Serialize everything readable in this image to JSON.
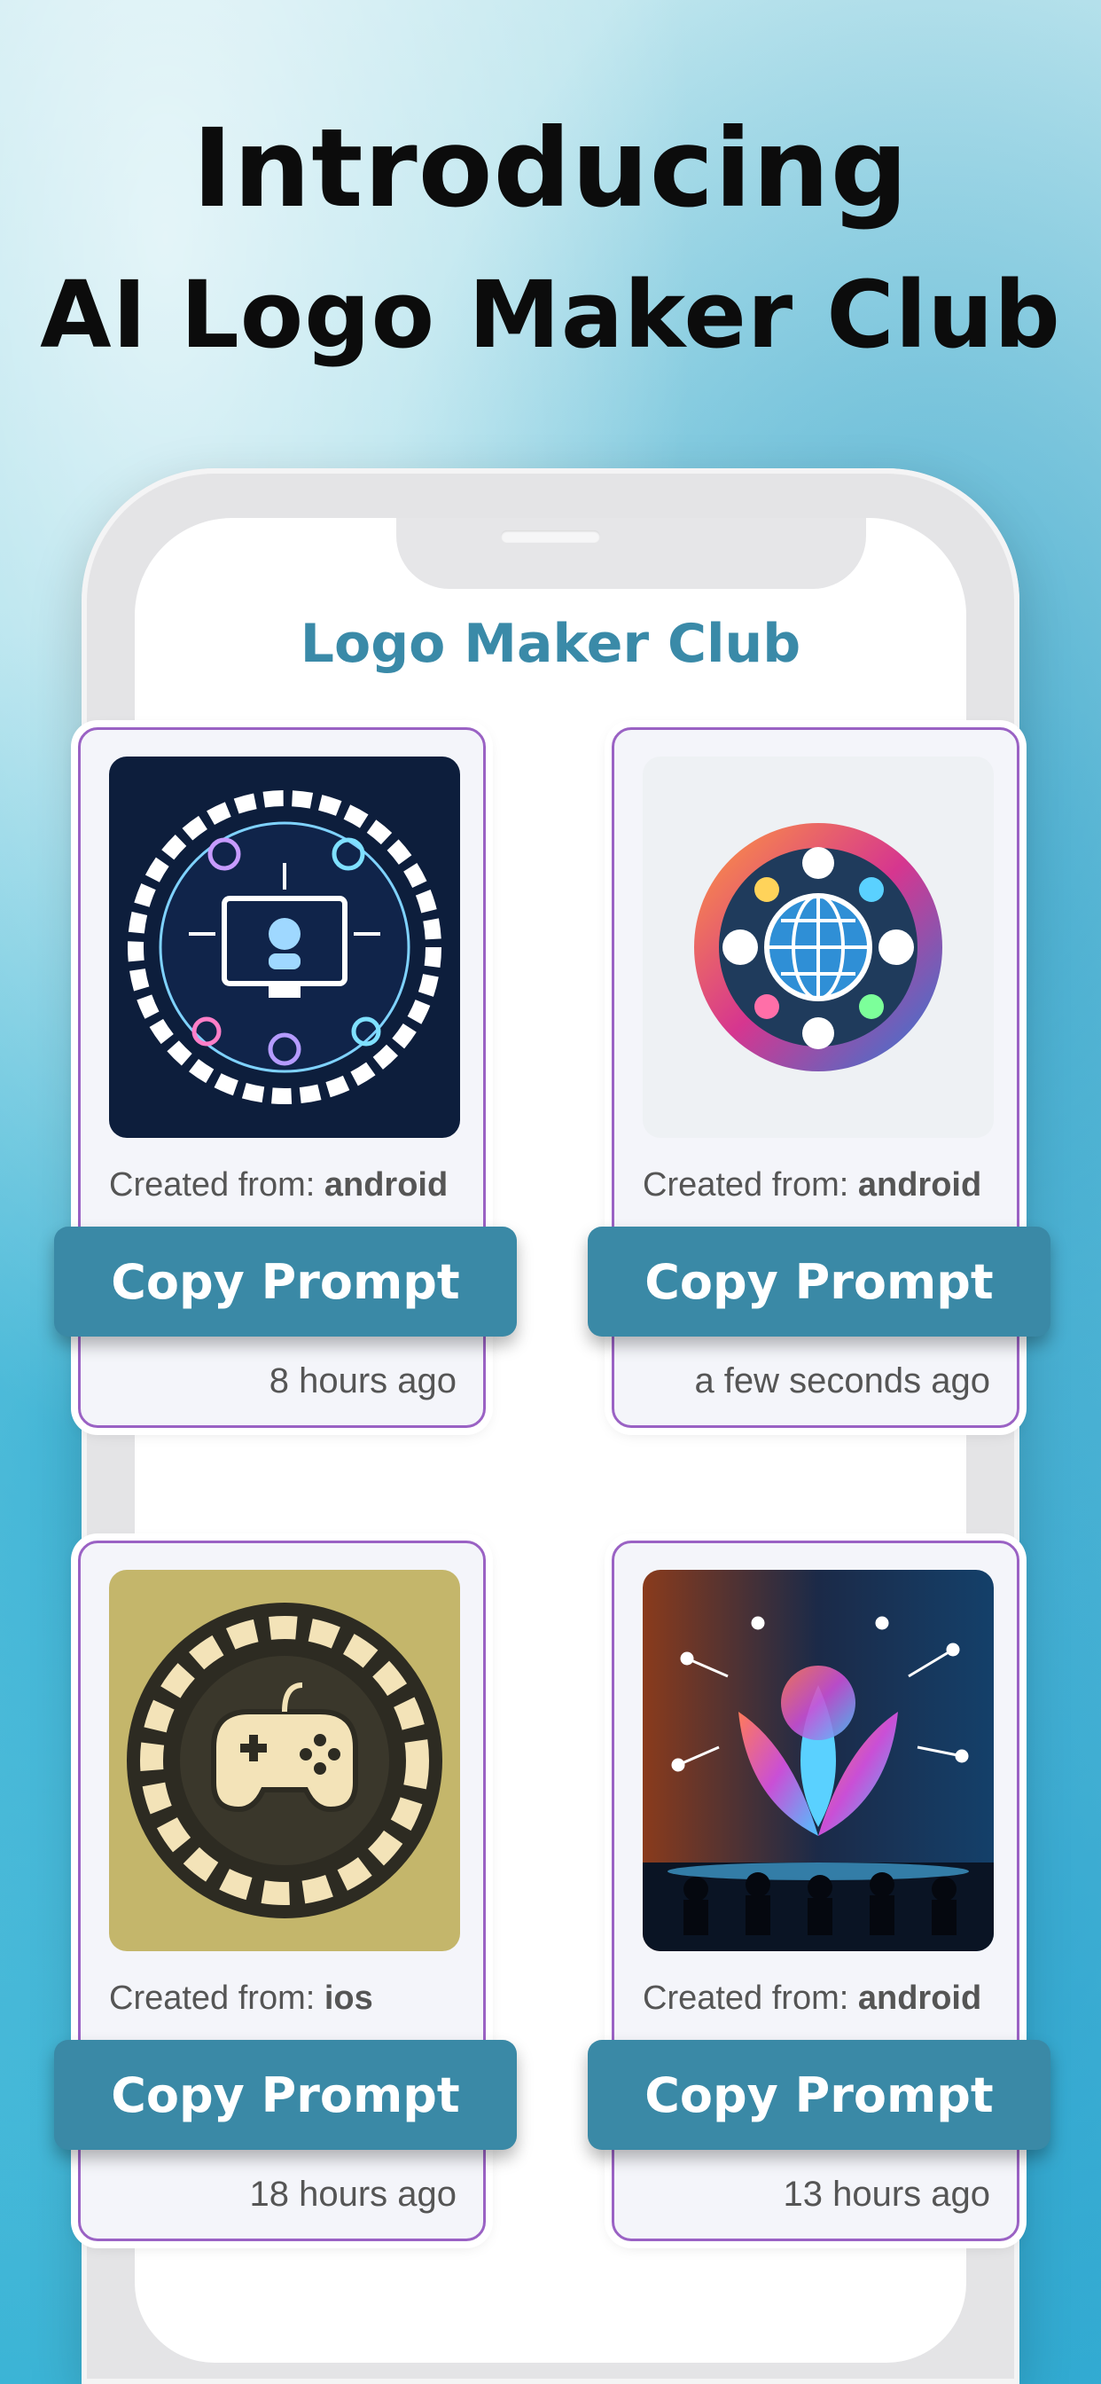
{
  "headline": {
    "line1": "Introducing",
    "line2": "AI Logo Maker Club"
  },
  "app": {
    "title": "Logo Maker Club",
    "accent_color": "#3a89a6",
    "card_border_color": "#9a62c4"
  },
  "cards": [
    {
      "image_icon": "tech-circle-logo",
      "created_label": "Created from: ",
      "platform": "android",
      "button_label": "Copy Prompt",
      "time": "8 hours ago"
    },
    {
      "image_icon": "globe-network-logo",
      "created_label": "Created from: ",
      "platform": "android",
      "button_label": "Copy Prompt",
      "time": "a few seconds ago"
    },
    {
      "image_icon": "gamepad-circle-logo",
      "created_label": "Created from: ",
      "platform": "ios",
      "button_label": "Copy Prompt",
      "time": "18 hours ago"
    },
    {
      "image_icon": "leaf-network-logo",
      "created_label": "Created from: ",
      "platform": "android",
      "button_label": "Copy Prompt",
      "time": "13 hours ago"
    }
  ]
}
